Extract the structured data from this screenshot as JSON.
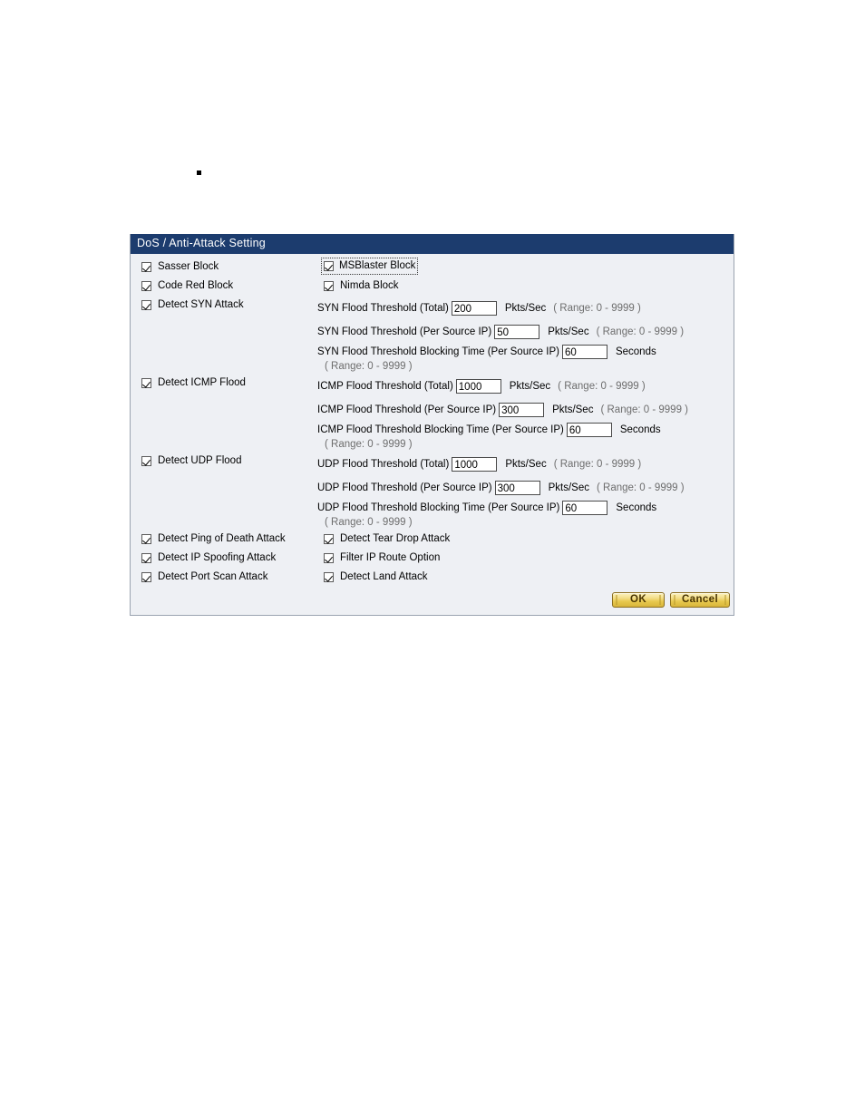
{
  "page": {
    "bullet": "square-bullet"
  },
  "panel": {
    "title": "DoS / Anti-Attack Setting",
    "header_bg": "#1c3c6e",
    "header_text_color": "#ffffff",
    "body_bg": "#eef0f4",
    "border_color": "#9aa3b0"
  },
  "checkboxes": {
    "sasser_block": {
      "label": "Sasser Block",
      "checked": true
    },
    "msblaster_block": {
      "label": "MSBlaster Block",
      "checked": true,
      "focused": true
    },
    "code_red_block": {
      "label": "Code Red Block",
      "checked": true
    },
    "nimda_block": {
      "label": "Nimda Block",
      "checked": true
    },
    "detect_syn_attack": {
      "label": "Detect SYN Attack",
      "checked": true
    },
    "detect_icmp_flood": {
      "label": "Detect ICMP Flood",
      "checked": true
    },
    "detect_udp_flood": {
      "label": "Detect UDP Flood",
      "checked": true
    },
    "detect_ping_of_death": {
      "label": "Detect Ping of Death Attack",
      "checked": true
    },
    "detect_tear_drop": {
      "label": "Detect Tear Drop Attack",
      "checked": true
    },
    "detect_ip_spoofing": {
      "label": "Detect IP Spoofing Attack",
      "checked": true
    },
    "filter_ip_route_option": {
      "label": "Filter IP Route Option",
      "checked": true
    },
    "detect_port_scan": {
      "label": "Detect Port Scan Attack",
      "checked": true
    },
    "detect_land_attack": {
      "label": "Detect Land Attack",
      "checked": true
    }
  },
  "fields": {
    "syn_total": {
      "label": "SYN Flood Threshold (Total)",
      "value": "200",
      "unit": "Pkts/Sec",
      "range": "( Range: 0 - 9999 )"
    },
    "syn_per_source": {
      "label": "SYN Flood Threshold (Per Source IP)",
      "value": "50",
      "unit": "Pkts/Sec",
      "range": "( Range: 0 - 9999 )"
    },
    "syn_blocking_time": {
      "label": "SYN Flood Threshold Blocking Time (Per Source IP)",
      "value": "60",
      "unit": "Seconds",
      "range": "( Range: 0 - 9999 )"
    },
    "icmp_total": {
      "label": "ICMP Flood Threshold (Total)",
      "value": "1000",
      "unit": "Pkts/Sec",
      "range": "( Range: 0 - 9999 )"
    },
    "icmp_per_source": {
      "label": "ICMP Flood Threshold (Per Source IP)",
      "value": "300",
      "unit": "Pkts/Sec",
      "range": "( Range: 0 - 9999 )"
    },
    "icmp_blocking_time": {
      "label": "ICMP Flood Threshold Blocking Time (Per Source IP)",
      "value": "60",
      "unit": "Seconds",
      "range": "( Range: 0 - 9999 )"
    },
    "udp_total": {
      "label": "UDP Flood Threshold (Total)",
      "value": "1000",
      "unit": "Pkts/Sec",
      "range": "( Range: 0 - 9999 )"
    },
    "udp_per_source": {
      "label": "UDP Flood Threshold (Per Source IP)",
      "value": "300",
      "unit": "Pkts/Sec",
      "range": "( Range: 0 - 9999 )"
    },
    "udp_blocking_time": {
      "label": "UDP Flood Threshold Blocking Time (Per Source IP)",
      "value": "60",
      "unit": "Seconds",
      "range": "( Range: 0 - 9999 )"
    }
  },
  "buttons": {
    "ok": "OK",
    "cancel": "Cancel",
    "face_color": "#e8c94f",
    "text_color": "#4a3503"
  }
}
